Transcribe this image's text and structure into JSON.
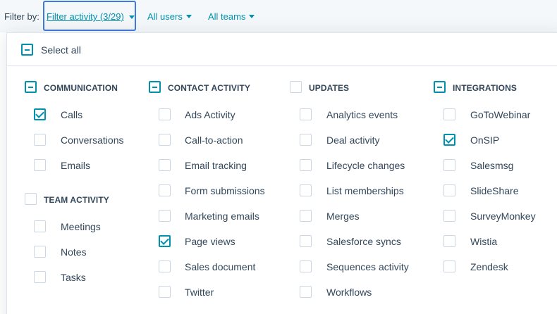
{
  "filterbar": {
    "label": "Filter by:",
    "activity_filter": "Filter activity (3/29)",
    "users_filter": "All users",
    "teams_filter": "All teams"
  },
  "panel": {
    "select_all": "Select all",
    "groups": {
      "communication": {
        "title": "COMMUNICATION",
        "items": [
          "Calls",
          "Conversations",
          "Emails"
        ]
      },
      "team_activity": {
        "title": "TEAM ACTIVITY",
        "items": [
          "Meetings",
          "Notes",
          "Tasks"
        ]
      },
      "contact_activity": {
        "title": "CONTACT ACTIVITY",
        "items": [
          "Ads Activity",
          "Call-to-action",
          "Email tracking",
          "Form submissions",
          "Marketing emails",
          "Page views",
          "Sales document",
          "Twitter"
        ]
      },
      "updates": {
        "title": "UPDATES",
        "items": [
          "Analytics events",
          "Deal activity",
          "Lifecycle changes",
          "List memberships",
          "Merges",
          "Salesforce syncs",
          "Sequences activity",
          "Workflows"
        ]
      },
      "integrations": {
        "title": "INTEGRATIONS",
        "items": [
          "GoToWebinar",
          "OnSIP",
          "Salesmsg",
          "SlideShare",
          "SurveyMonkey",
          "Wistia",
          "Zendesk"
        ]
      }
    }
  },
  "colors": {
    "accent": "#0091ae",
    "focus_border": "#3d7be0",
    "text": "#33475b",
    "checkbox_border": "#cbd6e2",
    "bar_background": "#f5f8fa"
  }
}
